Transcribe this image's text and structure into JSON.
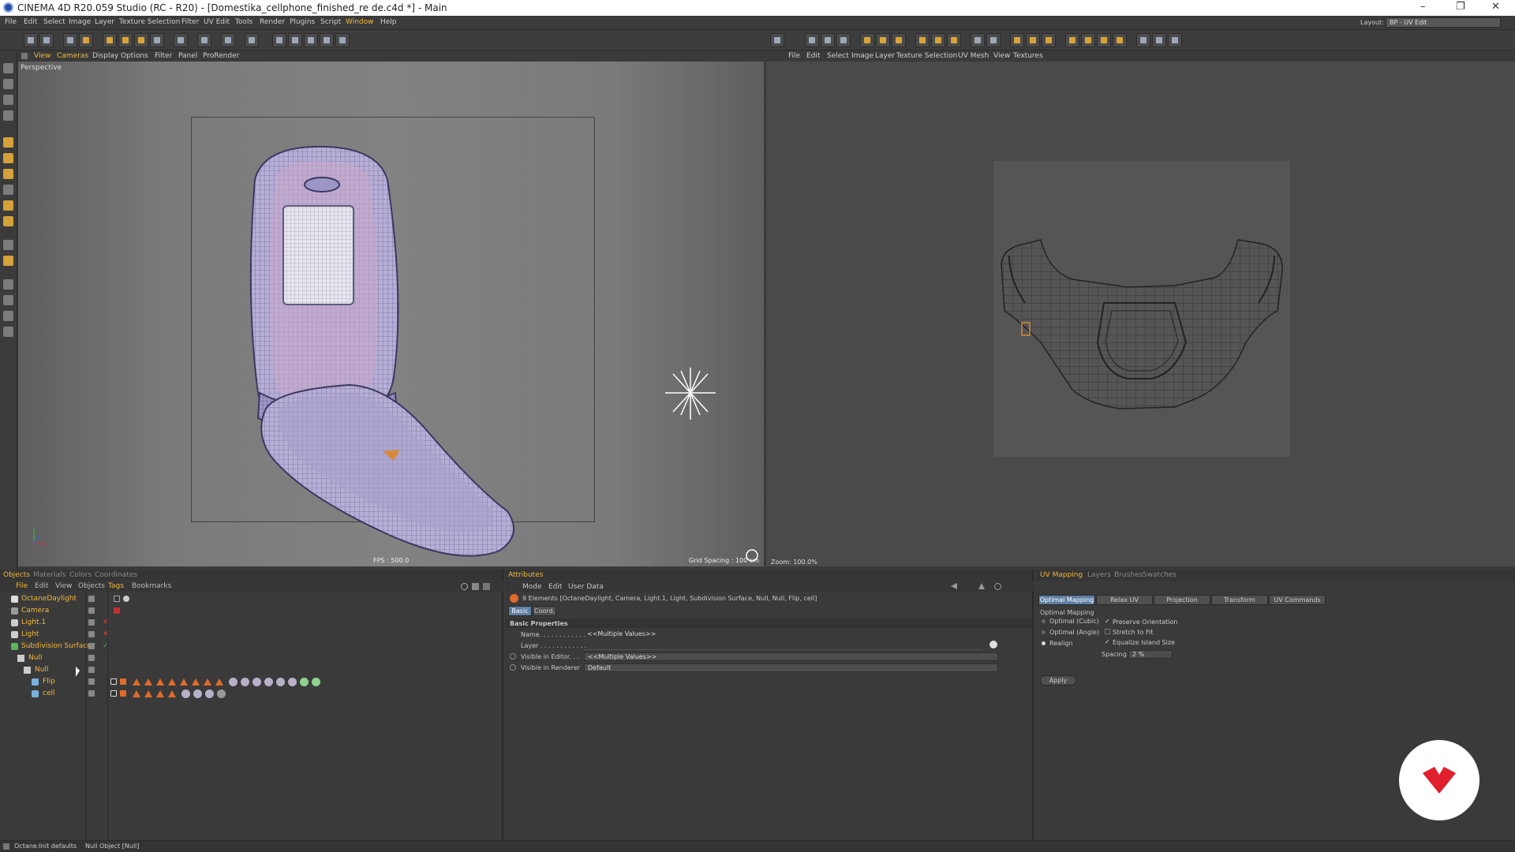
{
  "window": {
    "title": "CINEMA 4D R20.059 Studio (RC - R20) - [Domestika_cellphone_finished_re de.c4d *] - Main"
  },
  "menubar": {
    "items": [
      "File",
      "Edit",
      "Select",
      "Image",
      "Layer",
      "Texture Selection",
      "Filter",
      "UV Edit",
      "Tools",
      "Render",
      "Plugins",
      "Script",
      "Window",
      "Help"
    ],
    "active": "Window",
    "layout_label": "Layout:",
    "layout_value": "BP - UV Edit"
  },
  "viewport": {
    "menu": [
      "View",
      "Cameras",
      "Display",
      "Options",
      "Filter",
      "Panel",
      "ProRender"
    ],
    "label": "Perspective",
    "fps": "FPS : 500.0",
    "grid_spacing": "Grid Spacing : 100 cm"
  },
  "uv_editor": {
    "menu": [
      "File",
      "Edit",
      "Select",
      "Image",
      "Layer",
      "Texture Selection",
      "UV Mesh",
      "View",
      "Textures"
    ],
    "zoom": "Zoom: 100.0%"
  },
  "object_manager": {
    "tabs": [
      "Objects",
      "Materials",
      "Colors",
      "Coordinates"
    ],
    "menu": [
      "File",
      "Edit",
      "View",
      "Objects",
      "Tags",
      "Bookmarks"
    ],
    "objects": [
      {
        "name": "OctaneDaylight",
        "indent": 0
      },
      {
        "name": "Camera",
        "indent": 0
      },
      {
        "name": "Light.1",
        "indent": 0
      },
      {
        "name": "Light",
        "indent": 0
      },
      {
        "name": "Subdivision Surface",
        "indent": 0
      },
      {
        "name": "Null",
        "indent": 1
      },
      {
        "name": "Null",
        "indent": 2
      },
      {
        "name": "Flip",
        "indent": 3
      },
      {
        "name": "cell",
        "indent": 3
      }
    ]
  },
  "attributes": {
    "tab": "Attributes",
    "menu": [
      "Mode",
      "Edit",
      "User Data"
    ],
    "summary": "9 Elements [OctaneDaylight, Camera, Light.1, Light, Subdivision Surface, Null, Null, Flip, cell]",
    "subtabs": [
      "Basic",
      "Coord."
    ],
    "section": "Basic Properties",
    "name_label": "Name. . . . . . . . . . . .",
    "name_value": "<<Multiple Values>>",
    "layer_label": "Layer . . . . . . . . . . . .",
    "visible_editor_label": "Visible in Editor. . .",
    "visible_editor_value": "<<Multiple Values>>",
    "visible_renderer_label": "Visible in Renderer",
    "visible_renderer_value": "Default"
  },
  "uv_mapping": {
    "tabs": [
      "UV Mapping",
      "Layers",
      "Brushes",
      "Swatches"
    ],
    "subtabs": [
      "Optimal Mapping",
      "Relax UV",
      "Projection",
      "Transform",
      "UV Commands"
    ],
    "section": "Optimal Mapping",
    "options": [
      "Optimal (Cubic)",
      "Optimal (Angle)",
      "Realign"
    ],
    "checks": [
      "Preserve Orientation",
      "Stretch to Fit",
      "Equalize Island Size"
    ],
    "spacing_label": "Spacing",
    "spacing_value": "2 %",
    "apply": "Apply"
  },
  "status": {
    "left": "Octane:Init defaults",
    "right": "Null Object [Null]"
  },
  "colors": {
    "accent": "#f0b83c",
    "selected": "#5e7ea2",
    "logo": "#e0202c"
  }
}
